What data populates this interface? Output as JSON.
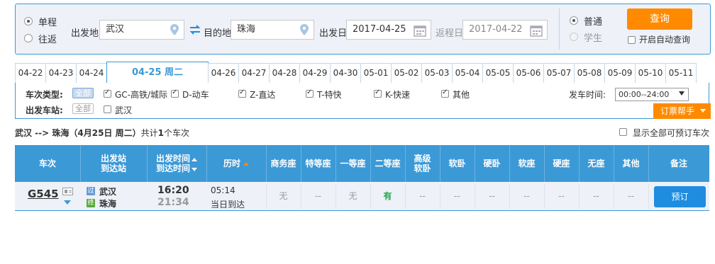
{
  "search": {
    "trip_type": [
      {
        "label": "单程",
        "checked": true
      },
      {
        "label": "往返",
        "checked": false
      }
    ],
    "from_label": "出发地",
    "from_value": "武汉",
    "to_label": "目的地",
    "to_value": "珠海",
    "depart_date_label": "出发日",
    "depart_date_value": "2017-04-25",
    "return_date_label": "返程日",
    "return_date_value": "2017-04-22",
    "passenger_type": [
      {
        "label": "普通",
        "checked": true
      },
      {
        "label": "学生",
        "checked": false
      }
    ],
    "query_button": "查询",
    "auto_query_label": "开启自动查询"
  },
  "date_tabs": [
    "04-22",
    "04-23",
    "04-24",
    "04-25 周二",
    "04-26",
    "04-27",
    "04-28",
    "04-29",
    "04-30",
    "05-01",
    "05-02",
    "05-03",
    "05-04",
    "05-05",
    "05-06",
    "05-07",
    "05-08",
    "05-09",
    "05-10",
    "05-11"
  ],
  "filter": {
    "train_type_title": "车次类型:",
    "all_label": "全部",
    "train_types": [
      "GC-高铁/城际",
      "D-动车",
      "Z-直达",
      "T-特快",
      "K-快速",
      "其他"
    ],
    "depart_station_title": "出发车站:",
    "stations": [
      "武汉"
    ],
    "depart_time_label": "发车时间:",
    "depart_time_value": "00:00--24:00",
    "helper_label": "订票帮手"
  },
  "summary": {
    "route": "武汉 --> 珠海（4月25日 周二）",
    "count_prefix": "共计",
    "count": "1",
    "count_suffix": "个车次",
    "show_all_label": "显示全部可预订车次"
  },
  "table": {
    "headers": {
      "train": "车次",
      "station_1": "出发站",
      "station_2": "到达站",
      "time_1": "出发时间",
      "time_2": "到达时间",
      "duration": "历时",
      "business": "商务座",
      "special": "特等座",
      "first": "一等座",
      "second": "二等座",
      "hsoft_1": "高级",
      "hsoft_2": "软卧",
      "soft_sleeper": "软卧",
      "hard_sleeper": "硬卧",
      "soft_seat": "软座",
      "hard_seat": "硬座",
      "no_seat": "无座",
      "other": "其他",
      "remark": "备注"
    },
    "rows": [
      {
        "train_no": "G545",
        "from_badge": "过",
        "from_station": "武汉",
        "to_badge": "终",
        "to_station": "珠海",
        "depart_time": "16:20",
        "arrive_time": "21:34",
        "duration": "05:14",
        "arrival_day": "当日到达",
        "business": "无",
        "special": "--",
        "first": "无",
        "second": "有",
        "high_soft_sleeper": "--",
        "soft_sleeper": "--",
        "hard_sleeper": "--",
        "soft_seat": "--",
        "hard_seat": "--",
        "no_seat": "--",
        "other": "--",
        "book_button": "预订"
      }
    ]
  },
  "colors": {
    "accent_blue": "#3b99d6",
    "orange": "#ff8a00",
    "available_green": "#21a84c",
    "book_blue": "#1e8de0"
  }
}
